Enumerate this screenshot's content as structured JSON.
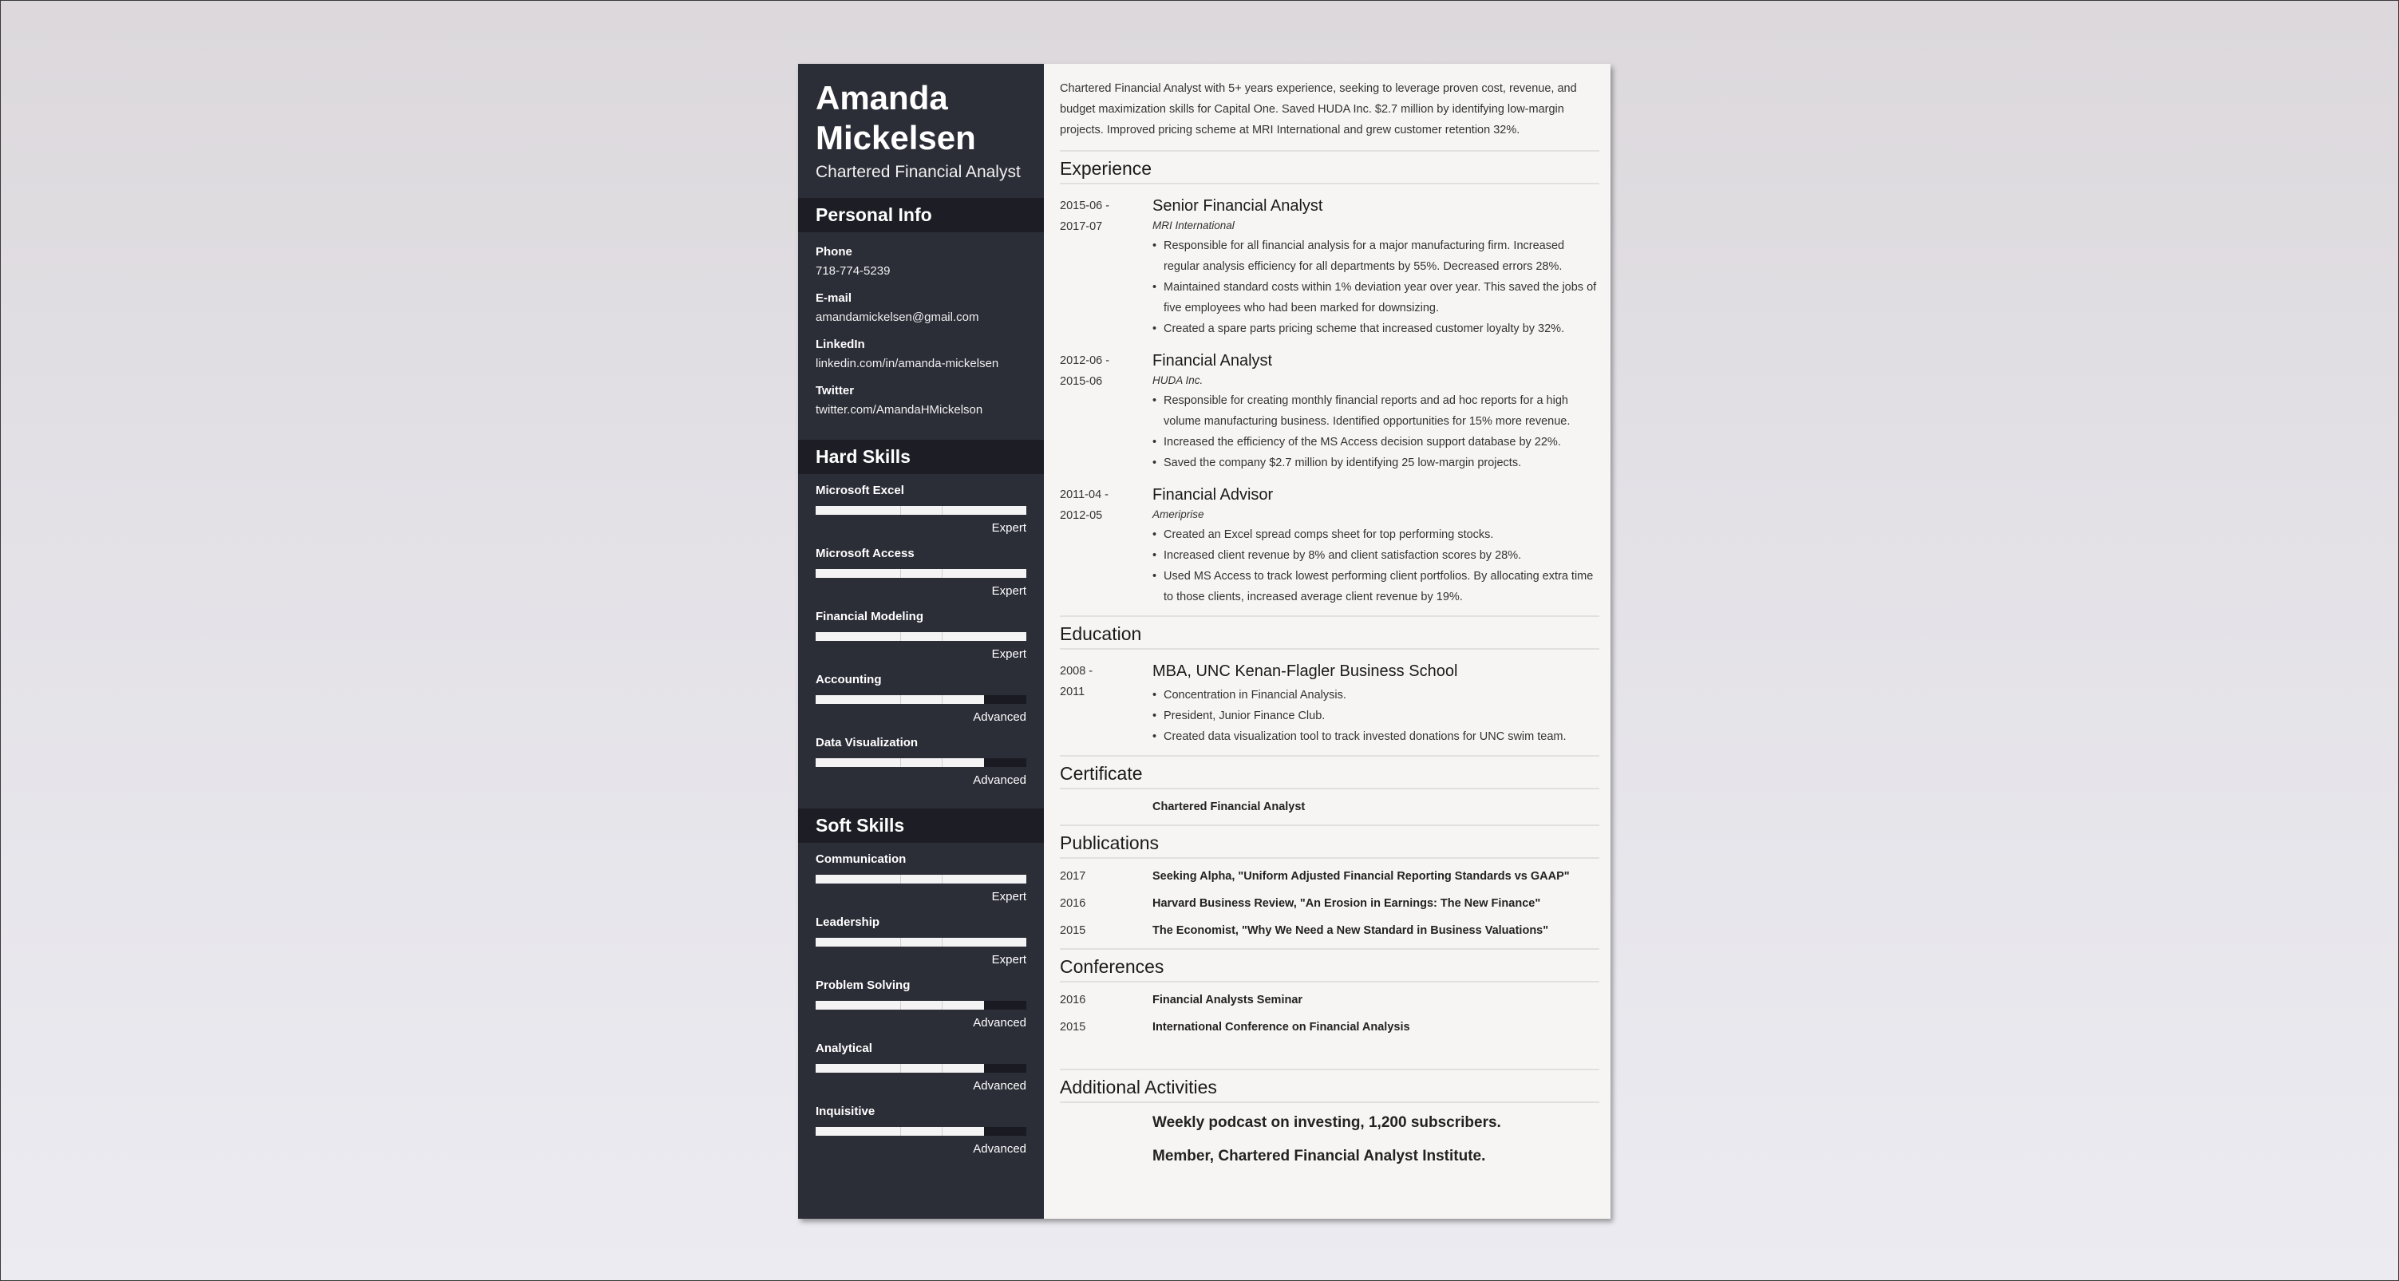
{
  "profile": {
    "first_name": "Amanda",
    "last_name": "Mickelsen",
    "title": "Chartered Financial Analyst"
  },
  "personal_info": {
    "heading": "Personal Info",
    "items": [
      {
        "label": "Phone",
        "value": "718-774-5239"
      },
      {
        "label": "E-mail",
        "value": "amandamickelsen@gmail.com"
      },
      {
        "label": "LinkedIn",
        "value": "linkedin.com/in/amanda-mickelsen"
      },
      {
        "label": "Twitter",
        "value": "twitter.com/AmandaHMickelson"
      }
    ]
  },
  "hard_skills": {
    "heading": "Hard Skills",
    "items": [
      {
        "name": "Microsoft Excel",
        "level": "Expert",
        "fill_pct": 100
      },
      {
        "name": "Microsoft Access",
        "level": "Expert",
        "fill_pct": 100
      },
      {
        "name": "Financial Modeling",
        "level": "Expert",
        "fill_pct": 100
      },
      {
        "name": "Accounting",
        "level": "Advanced",
        "fill_pct": 80
      },
      {
        "name": "Data Visualization",
        "level": "Advanced",
        "fill_pct": 80
      }
    ]
  },
  "soft_skills": {
    "heading": "Soft Skills",
    "items": [
      {
        "name": "Communication",
        "level": "Expert",
        "fill_pct": 100
      },
      {
        "name": "Leadership",
        "level": "Expert",
        "fill_pct": 100
      },
      {
        "name": "Problem Solving",
        "level": "Advanced",
        "fill_pct": 80
      },
      {
        "name": "Analytical",
        "level": "Advanced",
        "fill_pct": 80
      },
      {
        "name": "Inquisitive",
        "level": "Advanced",
        "fill_pct": 80
      }
    ]
  },
  "summary": "Chartered Financial Analyst with 5+ years experience, seeking to leverage proven cost, revenue, and budget maximization skills for Capital One. Saved HUDA Inc. $2.7 million by identifying low-margin projects. Improved pricing scheme at MRI International and grew customer retention 32%.",
  "experience": {
    "heading": "Experience",
    "items": [
      {
        "date_start": "2015-06 -",
        "date_end": "2017-07",
        "title": "Senior Financial Analyst",
        "company": "MRI International",
        "bullets": [
          "Responsible for all financial analysis for a major manufacturing firm. Increased regular analysis efficiency for all departments by 55%. Decreased errors 28%.",
          "Maintained standard costs within 1% deviation year over year. This saved the jobs of five employees who had been marked for downsizing.",
          "Created a spare parts pricing scheme that increased customer loyalty by 32%."
        ]
      },
      {
        "date_start": "2012-06 -",
        "date_end": "2015-06",
        "title": "Financial Analyst",
        "company": "HUDA Inc.",
        "bullets": [
          "Responsible for creating monthly financial reports and ad hoc reports for a high volume manufacturing business. Identified opportunities for 15% more revenue.",
          "Increased the efficiency of the MS Access decision support database by 22%.",
          "Saved the company $2.7 million by identifying 25 low-margin projects."
        ]
      },
      {
        "date_start": "2011-04 -",
        "date_end": "2012-05",
        "title": "Financial Advisor",
        "company": "Ameriprise",
        "bullets": [
          "Created an Excel spread comps sheet for top performing stocks.",
          "Increased client revenue by 8% and client satisfaction scores by 28%.",
          "Used MS Access to track lowest performing client portfolios. By allocating extra time to those clients, increased average client revenue by 19%."
        ]
      }
    ]
  },
  "education": {
    "heading": "Education",
    "items": [
      {
        "date_start": "2008 -",
        "date_end": "2011",
        "title": "MBA, UNC Kenan-Flagler Business School",
        "bullets": [
          "Concentration in Financial Analysis.",
          "President, Junior Finance Club.",
          "Created data visualization tool to track invested donations for UNC swim team."
        ]
      }
    ]
  },
  "certificate": {
    "heading": "Certificate",
    "items": [
      "Chartered Financial Analyst"
    ]
  },
  "publications": {
    "heading": "Publications",
    "items": [
      {
        "year": "2017",
        "text": "Seeking Alpha, \"Uniform Adjusted Financial Reporting Standards vs GAAP\""
      },
      {
        "year": "2016",
        "text": "Harvard Business Review, \"An Erosion in Earnings: The New Finance\""
      },
      {
        "year": "2015",
        "text": "The Economist, \"Why We Need a New Standard in Business Valuations\""
      }
    ]
  },
  "conferences": {
    "heading": "Conferences",
    "items": [
      {
        "year": "2016",
        "text": "Financial Analysts Seminar"
      },
      {
        "year": "2015",
        "text": "International Conference on Financial Analysis"
      }
    ]
  },
  "activities": {
    "heading": "Additional Activities",
    "items": [
      "Weekly podcast on investing, 1,200 subscribers.",
      "Member, Chartered Financial Analyst Institute."
    ]
  },
  "colors": {
    "sidebar_bg": "#2b2d37",
    "sidebar_header_bg": "#1d1e25",
    "main_bg": "#f6f5f3",
    "skill_fill": "#f4f4f4"
  }
}
